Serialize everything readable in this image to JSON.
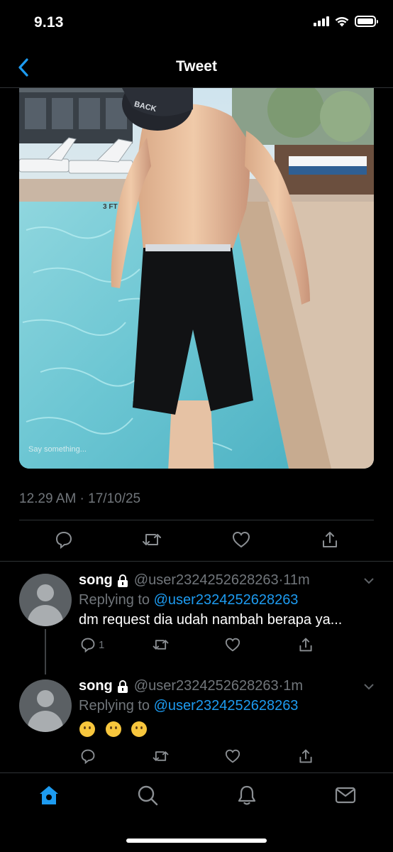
{
  "status_bar": {
    "time": "9.13"
  },
  "nav": {
    "title": "Tweet"
  },
  "tweet": {
    "media_caption": "Say something...",
    "timestamp": "12.29 AM · 17/10/25"
  },
  "replies": [
    {
      "name": "song",
      "handle": "@user2324252628263",
      "time": "·11m",
      "replying_prefix": "Replying to ",
      "replying_to": "@user2324252628263",
      "text": "dm request dia udah nambah berapa ya...",
      "reply_count": "1"
    },
    {
      "name": "song",
      "handle": "@user2324252628263",
      "time": "·1m",
      "replying_prefix": "Replying to ",
      "replying_to": "@user2324252628263",
      "emojis": [
        "neutral-face-emoji",
        "neutral-face-emoji",
        "neutral-face-emoji"
      ]
    }
  ],
  "colors": {
    "accent": "#1d9bf0",
    "muted": "#71767b",
    "divider": "#2f3336"
  },
  "tabs": [
    "home-icon",
    "search-icon",
    "notifications-icon",
    "messages-icon"
  ]
}
